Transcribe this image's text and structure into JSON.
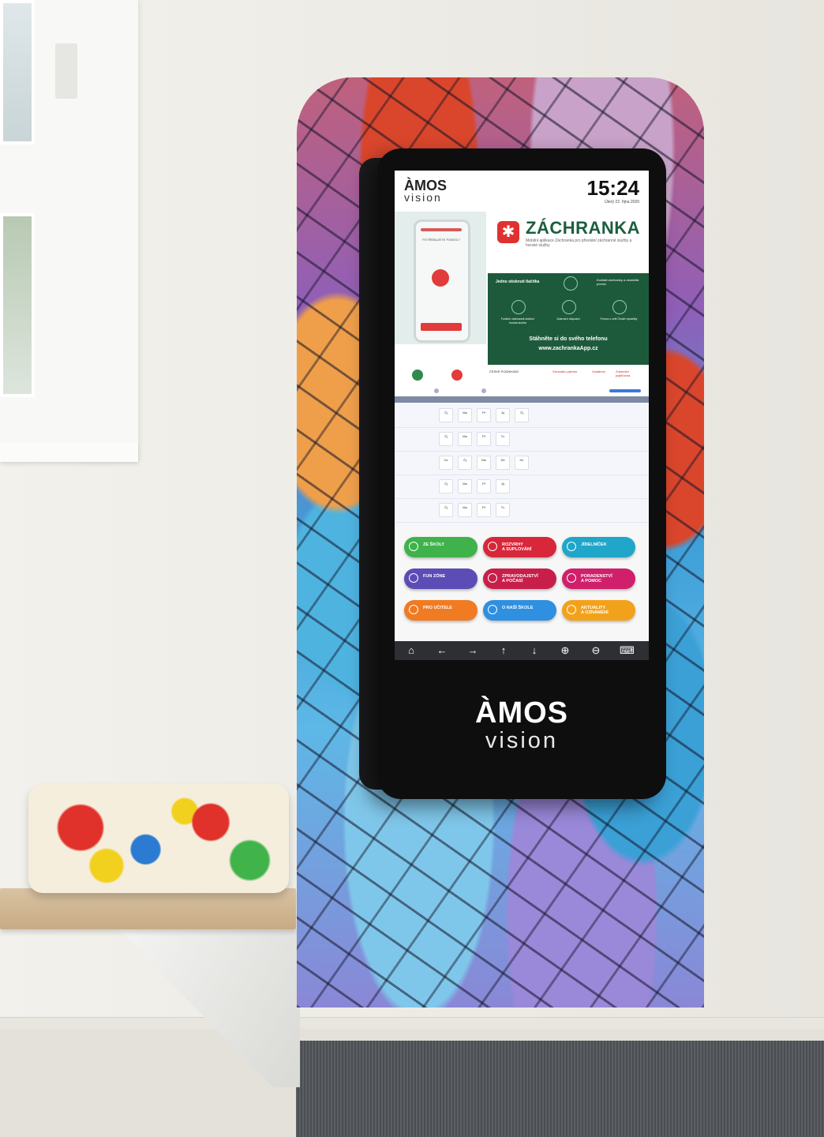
{
  "kiosk": {
    "brand_line1": "ÀMOS",
    "brand_line2": "vision"
  },
  "screen": {
    "header": {
      "logo_line1": "ÀMOS",
      "logo_line2": "vision",
      "clock": "15:24",
      "date": "Úterý 22. října 2020"
    },
    "banner": {
      "phone_message": "POTŘEBUJETE POMOC?",
      "title": "ZÁCHRANKA",
      "subtitle": "Mobilní aplikace Záchranka pro přivolání záchranné služby a horské služby",
      "step1": "Jedno stisknutí tlačítka",
      "step1_result": "Kontakt záchranky a okamžitá pomoc",
      "icon_captions": [
        "Funkční záchranná služba i horská služba",
        "Zdarma k dispozici",
        "Pomoc z celé České republiky"
      ],
      "cta_line1": "Stáhněte si do svého telefonu",
      "cta_line2": "www.zachrankaApp.cz"
    },
    "sponsors": [
      "ČESKÉ PODNIKÁNÍ",
      "Generální partner",
      "Vodafone",
      "Zdravotní pojišťovna"
    ],
    "timetable": {
      "rows": [
        [
          "Čj",
          "Ma",
          "Př",
          "Aj",
          "Čj"
        ],
        [
          "Čj",
          "Ma",
          "Př",
          "Tv"
        ],
        [
          "Ov",
          "Čj",
          "Ma",
          "Dě",
          "Hv"
        ],
        [
          "Čj",
          "Ma",
          "Př",
          "Aj"
        ],
        [
          "Čj",
          "Ma",
          "Př",
          "Tv"
        ]
      ]
    },
    "menu": [
      {
        "label": "ZE ŠKOLY",
        "color": "#3fb24b",
        "icon": "school-icon"
      },
      {
        "label": "ROZVRHY\nA SUPLOVÁNÍ",
        "color": "#d8263a",
        "icon": "clock-icon"
      },
      {
        "label": "JÍDELNÍČEK",
        "color": "#1fa6c9",
        "icon": "fork-knife-icon"
      },
      {
        "label": "FUN ZÓNE",
        "color": "#5b4cb6",
        "icon": "gamepad-icon"
      },
      {
        "label": "ZPRAVODAJSTVÍ\nA POČASÍ",
        "color": "#c81f4a",
        "icon": "microphone-icon"
      },
      {
        "label": "PORADENSTVÍ\nA POMOC",
        "color": "#d01f6b",
        "icon": "chat-icon"
      },
      {
        "label": "PRO UČITELE",
        "color": "#f07b22",
        "icon": "trophy-icon"
      },
      {
        "label": "O NAŠÍ ŠKOLE",
        "color": "#2f8fe0",
        "icon": "info-icon"
      },
      {
        "label": "AKTUALITY\nA OZNÁMENÍ",
        "color": "#f2a21a",
        "icon": "bell-icon"
      }
    ],
    "nav": [
      {
        "glyph": "⌂",
        "icon": "home-icon"
      },
      {
        "glyph": "←",
        "icon": "arrow-left-icon"
      },
      {
        "glyph": "→",
        "icon": "arrow-right-icon"
      },
      {
        "glyph": "↑",
        "icon": "arrow-up-icon"
      },
      {
        "glyph": "↓",
        "icon": "arrow-down-icon"
      },
      {
        "glyph": "⊕",
        "icon": "zoom-in-icon"
      },
      {
        "glyph": "⊖",
        "icon": "zoom-out-icon"
      },
      {
        "glyph": "⌨",
        "icon": "keyboard-icon"
      }
    ]
  }
}
